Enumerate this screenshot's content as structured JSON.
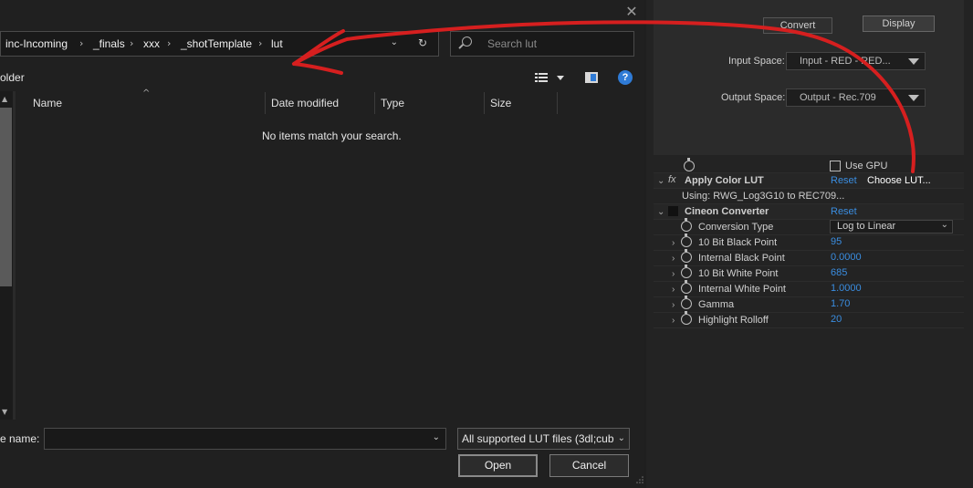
{
  "rightPanel": {
    "tabs": [
      "Convert",
      "Display"
    ],
    "inputSpace": {
      "label": "Input Space:",
      "value": "Input - RED - RED..."
    },
    "outputSpace": {
      "label": "Output Space:",
      "value": "Output - Rec.709"
    },
    "useGpu": "Use GPU",
    "applyColorLut": {
      "fx": "fx",
      "title": "Apply Color LUT",
      "reset": "Reset",
      "choose": "Choose LUT...",
      "using": "Using: RWG_Log3G10 to REC709..."
    },
    "cineon": {
      "title": "Cineon Converter",
      "reset": "Reset",
      "conversionType": {
        "label": "Conversion Type",
        "value": "Log to Linear"
      },
      "params": [
        {
          "label": "10 Bit Black Point",
          "value": "95"
        },
        {
          "label": "Internal Black Point",
          "value": "0.0000"
        },
        {
          "label": "10 Bit White Point",
          "value": "685"
        },
        {
          "label": "Internal White Point",
          "value": "1.0000"
        },
        {
          "label": "Gamma",
          "value": "1.70"
        },
        {
          "label": "Highlight Rolloff",
          "value": "20"
        }
      ]
    }
  },
  "dialog": {
    "close": "✕",
    "breadcrumb": [
      "inc-Incoming",
      "_finals",
      "xxx",
      "_shotTemplate",
      "lut"
    ],
    "searchPlaceholder": "Search lut",
    "newFolder": "older",
    "helpIcon": "?",
    "columns": [
      "Name",
      "Date modified",
      "Type",
      "Size"
    ],
    "emptyMessage": "No items match your search.",
    "fileNameLabel": "e name:",
    "fileTypeValue": "All supported LUT files (3dl;cub",
    "openLabel": "Open",
    "cancelLabel": "Cancel"
  },
  "colors": {
    "annotation": "#d61f1f",
    "link": "#3a8de0",
    "accent": "#2f7bd6"
  }
}
